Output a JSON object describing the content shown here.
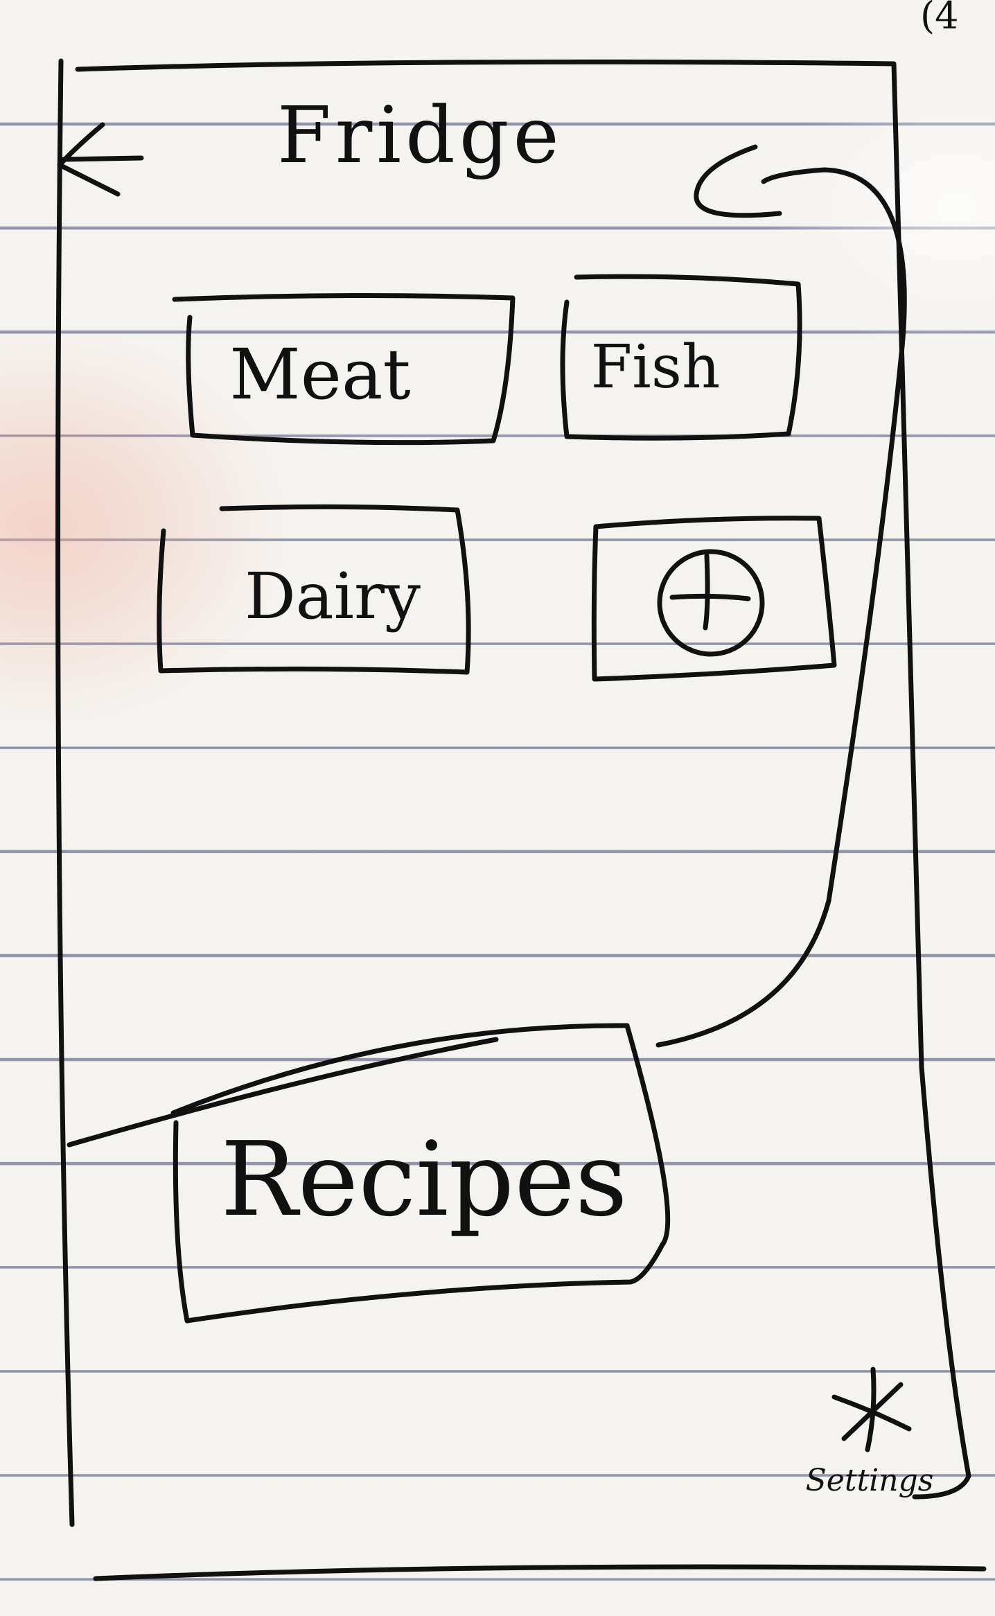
{
  "screen": {
    "title": "Fridge",
    "corner_note": "(4"
  },
  "navigation": {
    "back_icon": "left-arrow-icon"
  },
  "categories": [
    {
      "label": "Meat"
    },
    {
      "label": "Fish"
    },
    {
      "label": "Dairy"
    }
  ],
  "add_category": {
    "icon": "plus-circle-icon"
  },
  "recipes_button": {
    "label": "Recipes"
  },
  "settings": {
    "icon": "asterisk-icon",
    "label": "Settings"
  }
}
